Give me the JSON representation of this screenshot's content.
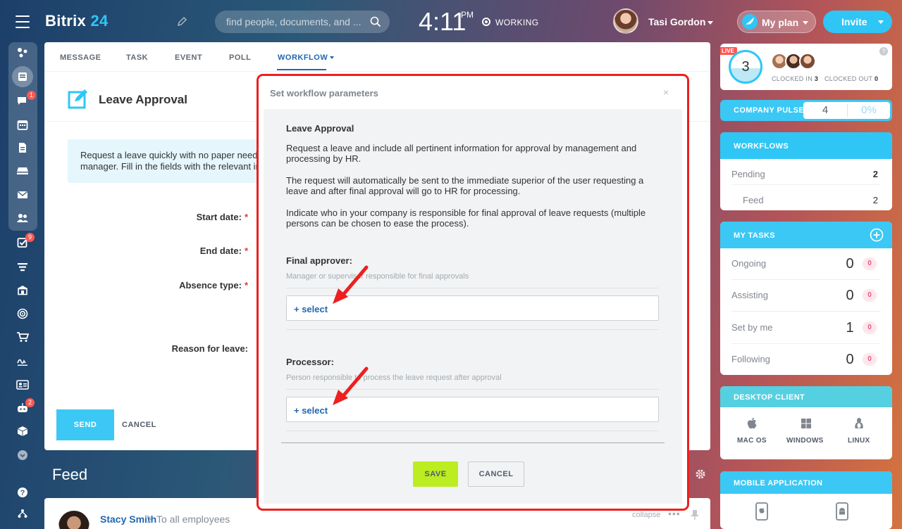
{
  "brand": {
    "name": "Bitrix",
    "suffix": " 24"
  },
  "search": {
    "placeholder": "find people, documents, and ..."
  },
  "clock": {
    "time": "4:11",
    "ampm": "PM",
    "status": "WORKING"
  },
  "user": {
    "name": "Tasi Gordon"
  },
  "header": {
    "my_plan": "My plan",
    "invite": "Invite"
  },
  "sidebar": {
    "badges": {
      "chat": "1",
      "tasks": "9",
      "robots": "2"
    }
  },
  "main": {
    "tabs": [
      "MESSAGE",
      "TASK",
      "EVENT",
      "POLL",
      "WORKFLOW"
    ],
    "form_title": "Leave Approval",
    "info_text": "Request a leave quickly with no paper needed. Please send your request to the manager. Fill in the fields with the relevant information.",
    "fields": {
      "start": "Start date:",
      "end": "End date:",
      "absence": "Absence type:",
      "reason": "Reason for leave:"
    },
    "required_mark": "*",
    "send": "SEND",
    "cancel": "CANCEL"
  },
  "feed": {
    "title": "Feed",
    "author": "Stacy Smith",
    "to": "To all employees",
    "collapse": "collapse"
  },
  "modal": {
    "title": "Set workflow parameters",
    "close": "×",
    "heading": "Leave Approval",
    "p1": "Request a leave and include all pertinent information for approval by management and processing by HR.",
    "p2": "The request will automatically be sent to the immediate superior of the user requesting a leave and after final approval will go to HR for processing.",
    "p3": "Indicate who in your company is responsible for final approval of leave requests (multiple persons can be chosen to ease the process).",
    "approver_label": "Final approver:",
    "approver_hint": "Manager or supervisor responsible for final approvals",
    "processor_label": "Processor:",
    "processor_hint": "Person responsible to process the leave request after approval",
    "select": "+ select",
    "save": "SAVE",
    "cancel": "CANCEL",
    "annotation_color": "#ee1f1f"
  },
  "right": {
    "live": {
      "badge": "LIVE",
      "count": "3",
      "clocked_in_label": "CLOCKED IN",
      "clocked_in": "3",
      "clocked_out_label": "CLOCKED OUT",
      "clocked_out": "0"
    },
    "pulse": {
      "label": "COMPANY PULSE",
      "value": "4",
      "percent": "0%"
    },
    "workflows": {
      "title": "WORKFLOWS",
      "pending_label": "Pending",
      "pending": "2",
      "feed_label": "Feed",
      "feed": "2"
    },
    "tasks": {
      "title": "MY TASKS",
      "rows": [
        {
          "label": "Ongoing",
          "count": "0",
          "badge": "0"
        },
        {
          "label": "Assisting",
          "count": "0",
          "badge": "0"
        },
        {
          "label": "Set by me",
          "count": "1",
          "badge": "0"
        },
        {
          "label": "Following",
          "count": "0",
          "badge": "0"
        }
      ]
    },
    "desktop": {
      "title": "DESKTOP CLIENT",
      "mac": "MAC OS",
      "windows": "WINDOWS",
      "linux": "LINUX"
    },
    "mobile": {
      "title": "MOBILE APPLICATION"
    }
  },
  "colors": {
    "accent": "#2fc6f6",
    "link": "#2067b0",
    "save": "#bbed21",
    "badge": "#ff5752"
  }
}
